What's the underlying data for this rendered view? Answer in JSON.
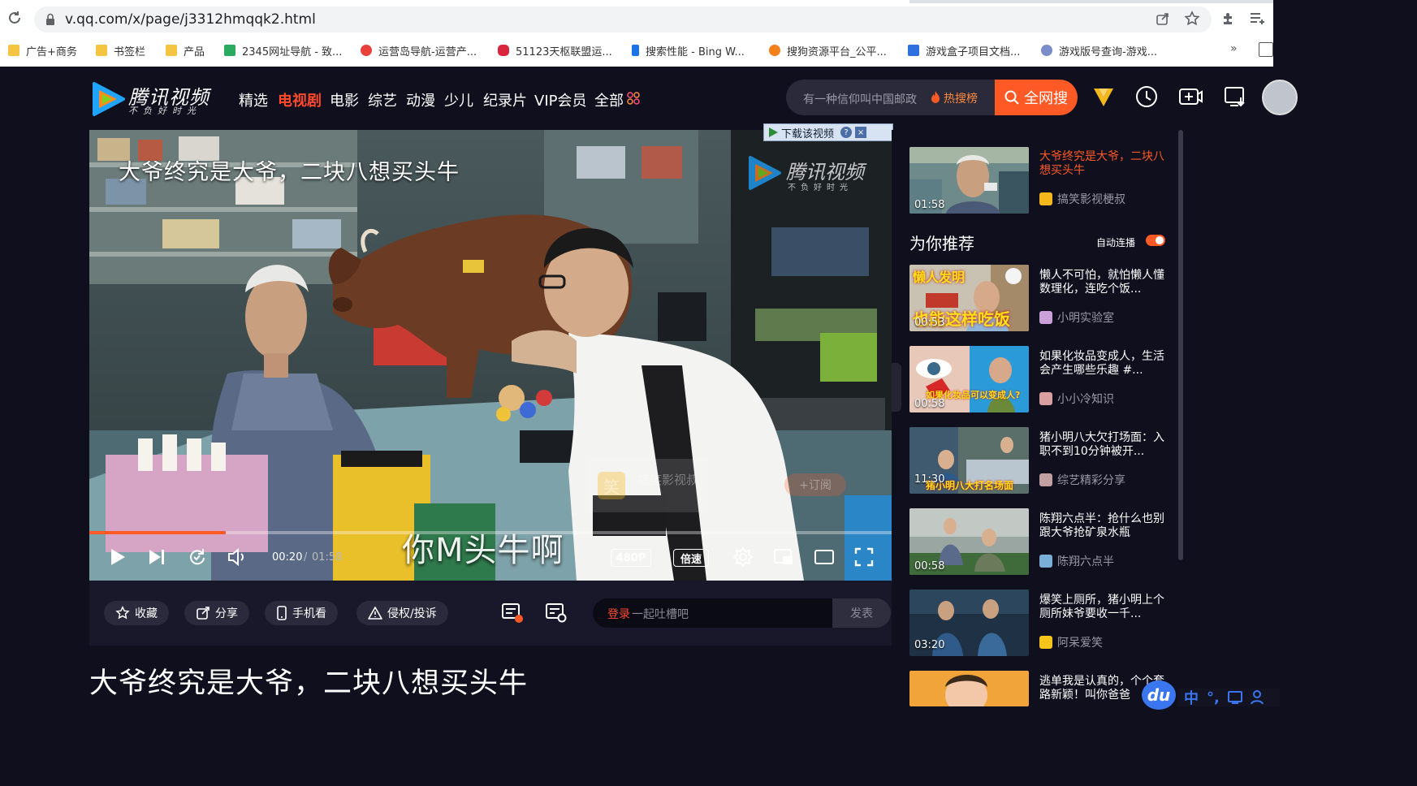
{
  "browser": {
    "url": "v.qq.com/x/page/j3312hmqqk2.html",
    "bookmarks": [
      {
        "label": "广告+商务",
        "icon": "folder-icon"
      },
      {
        "label": "书签栏",
        "icon": "folder-icon"
      },
      {
        "label": "产品",
        "icon": "folder-icon"
      },
      {
        "label": "2345网址导航 - 致...",
        "icon": "2345-icon"
      },
      {
        "label": "运营岛导航-运营产...",
        "icon": "yunyingdao-icon"
      },
      {
        "label": "51123天枢联盟运...",
        "icon": "tianshu-icon"
      },
      {
        "label": "搜索性能 - Bing W...",
        "icon": "bing-icon"
      },
      {
        "label": "搜狗资源平台_公平...",
        "icon": "sogou-icon"
      },
      {
        "label": "游戏盒子项目文档...",
        "icon": "doc-icon"
      },
      {
        "label": "游戏版号查询-游戏...",
        "icon": "game-icon"
      }
    ],
    "more_label": "»"
  },
  "header": {
    "logo_text": "腾讯视频",
    "logo_slogan": "不负好时光",
    "nav": [
      "精选",
      "电视剧",
      "电影",
      "综艺",
      "动漫",
      "少儿",
      "纪录片",
      "VIP会员",
      "全部"
    ],
    "nav_active_index": 1,
    "search_placeholder": "有一种信仰叫中国邮政",
    "hot_label": "热搜榜",
    "search_button": "全网搜"
  },
  "player": {
    "title_overlay": "大爷终究是大爷，二块八想买头牛",
    "watermark_text": "腾讯视频",
    "watermark_sub": "不负好时光",
    "download_label": "下载该视频",
    "download_help": "?",
    "download_close": "×",
    "subtitle": "你M头牛啊",
    "time_current": "00:20",
    "time_sep": "/",
    "time_total": "01:58",
    "progress": 0.17,
    "quality": "480P",
    "speed": "倍速",
    "faded_owner": "搞笑影视叔",
    "faded_owner_badge": "笑",
    "faded_subscribe": "+订阅"
  },
  "actions": {
    "collect": "收藏",
    "share": "分享",
    "mobile": "手机看",
    "report": "侵权/投诉",
    "comment_login": "登录",
    "comment_placeholder": "一起吐槽吧",
    "comment_send": "发表"
  },
  "page_title": "大爷终究是大爷，二块八想买头牛",
  "sidebar": {
    "current": {
      "title": "大爷终究是大爷，二块八想买头牛",
      "owner": "搞笑影视梗叔",
      "duration": "01:58"
    },
    "recommend_heading": "为你推荐",
    "autoplay_label": "自动连播",
    "autoplay_on": true,
    "items": [
      {
        "title": "懒人不可怕，就怕懒人懂数理化，连吃个饭...",
        "owner": "小明实验室",
        "duration": "00:53",
        "thumb_text_top": "懒人发明",
        "thumb_text_bottom": "也能这样吃饭"
      },
      {
        "title": "如果化妆品变成人，生活会产生哪些乐趣 #...",
        "owner": "小小冷知识",
        "duration": "00:58",
        "thumb_text_bottom": "如果化妆品可以变成人?"
      },
      {
        "title": "猪小明八大欠打场面：入职不到10分钟被开...",
        "owner": "综艺精彩分享",
        "duration": "11:30",
        "thumb_text_bottom": "猪小明八大打名场面"
      },
      {
        "title": "陈翔六点半：抢什么也别跟大爷抢矿泉水瓶",
        "owner": "陈翔六点半",
        "duration": "00:58"
      },
      {
        "title": "爆笑上厕所，猪小明上个厕所妹爷要收一千...",
        "owner": "阿呆爱笑",
        "duration": "03:20"
      },
      {
        "title": "逃单我是认真的，个个套路新颖！叫你爸爸",
        "owner": "",
        "duration": ""
      }
    ]
  },
  "ime": {
    "badge": "du",
    "lang": "中",
    "punct": "°,"
  },
  "colors": {
    "accent": "#ff5a26",
    "active_nav": "#ff4a2c",
    "page_bg": "#0f0f1e"
  }
}
